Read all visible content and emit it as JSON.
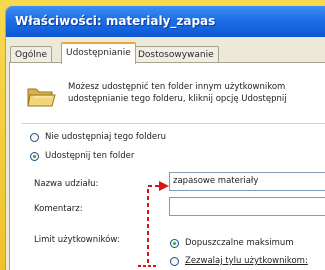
{
  "window": {
    "title": "Właściwości: materialy_zapas"
  },
  "tabs": [
    {
      "label": "Ogólne"
    },
    {
      "label": "Udostępnianie"
    },
    {
      "label": "Dostosowywanie"
    }
  ],
  "sharing": {
    "info_line1": "Możesz udostępnić ten folder innym użytkownikom",
    "info_line2": "udostępnianie tego folderu, kliknij opcję Udostępnij",
    "option_no_share": "Nie udostępniaj tego folderu",
    "option_share": "Udostępnij ten folder",
    "share_name_label": "Nazwa udziału:",
    "share_name_value": "zapasowe materiały",
    "comment_label": "Komentarz:",
    "comment_value": "",
    "user_limit_label": "Limit użytkowników:",
    "limit_max": "Dopuszczalne maksimum",
    "limit_allow": "Zezwalaj tylu użytkownikom:"
  },
  "colors": {
    "titlebar": "#0c58d4",
    "frame": "#f4cf3a",
    "annotation": "#d9141a"
  }
}
